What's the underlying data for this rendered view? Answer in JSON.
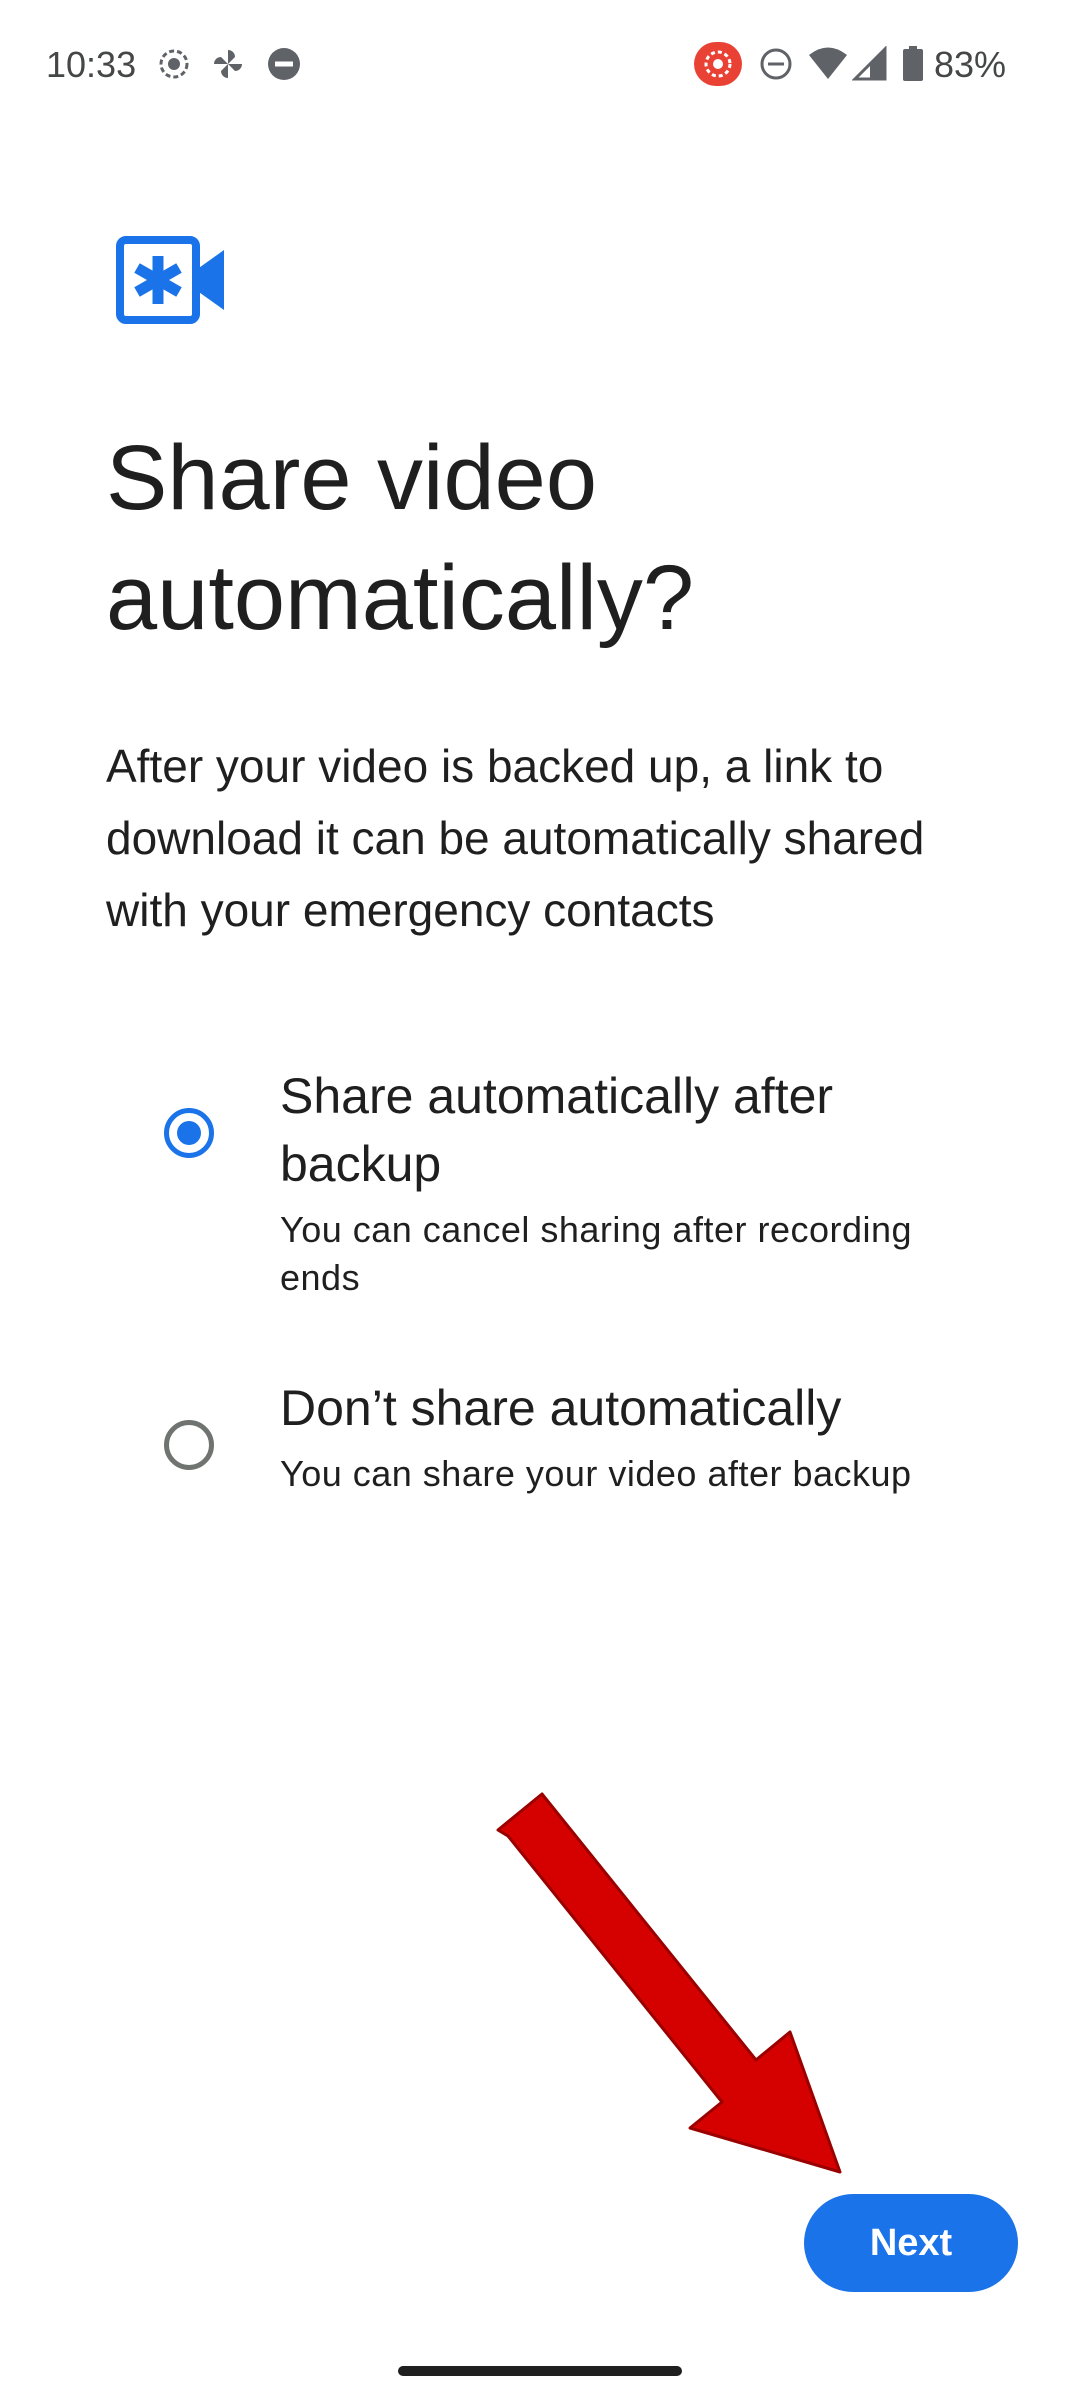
{
  "status_bar": {
    "time": "10:33",
    "battery_percent": "83%",
    "left_icons": [
      "screen-record-icon",
      "pinwheel-icon",
      "do-not-disturb-icon"
    ],
    "right_icons": [
      "recording-indicator-icon",
      "do-not-disturb-icon",
      "wifi-icon",
      "cell-signal-icon",
      "battery-icon"
    ]
  },
  "app": {
    "icon": "emergency-video-icon",
    "accent_color": "#1a73e8"
  },
  "page": {
    "title": "Share video automatically?",
    "description": "After your video is backed up, a link to download it can be automatically shared with your emergency contacts"
  },
  "options": [
    {
      "title": "Share automatically after backup",
      "subtitle": "You can cancel sharing after recording ends",
      "selected": true
    },
    {
      "title": "Don’t share automatically",
      "subtitle": "You can share your video after backup",
      "selected": false
    }
  ],
  "actions": {
    "next_label": "Next"
  },
  "annotation": {
    "arrow_color": "#d50000",
    "points_to": "next-button"
  }
}
